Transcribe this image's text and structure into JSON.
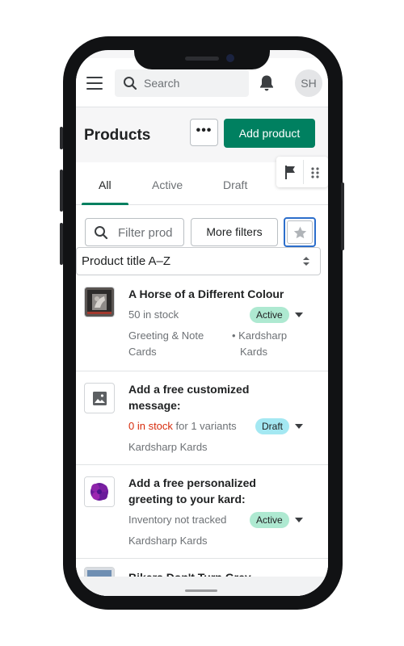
{
  "topbar": {
    "search_placeholder": "Search",
    "avatar_initials": "SH",
    "icons": [
      "menu-icon",
      "search-icon",
      "bell-icon"
    ]
  },
  "header": {
    "title": "Products",
    "more_label": "•••",
    "add_product_label": "Add product"
  },
  "tabs": [
    {
      "label": "All",
      "selected": true
    },
    {
      "label": "Active",
      "selected": false
    },
    {
      "label": "Draft",
      "selected": false
    }
  ],
  "filters": {
    "filter_placeholder": "Filter prod",
    "more_filters_label": "More filters",
    "sort_value": "Product title A–Z"
  },
  "products": [
    {
      "title": "A Horse of a Different Colour",
      "stock": "50 in stock",
      "status": "Active",
      "type_line1": "Greeting & Note",
      "type_line2": "Cards",
      "vendor_line1": "Kardsharp",
      "vendor_line2": "Kards",
      "thumb": "photo-thumbnail"
    },
    {
      "title_line1": "Add a free customized",
      "title_line2": "message:",
      "stock_zero": "0 in stock",
      "stock_rest": " for 1 variants",
      "status": "Draft",
      "vendor": "Kardsharp Kards",
      "thumb": "image-placeholder-icon"
    },
    {
      "title_line1": "Add a free personalized",
      "title_line2": "greeting to your kard:",
      "stock": "Inventory not tracked",
      "status": "Active",
      "vendor": "Kardsharp Kards",
      "thumb": "purple-flower-thumbnail"
    },
    {
      "title": "Bikers Don't Turn Grey",
      "thumb": "photo-thumbnail"
    }
  ],
  "colors": {
    "primary": "#008060",
    "active_badge": "#aee9d1",
    "draft_badge": "#a4e8f2",
    "critical_text": "#d72c0d",
    "focus_ring": "#2c6ecb"
  }
}
